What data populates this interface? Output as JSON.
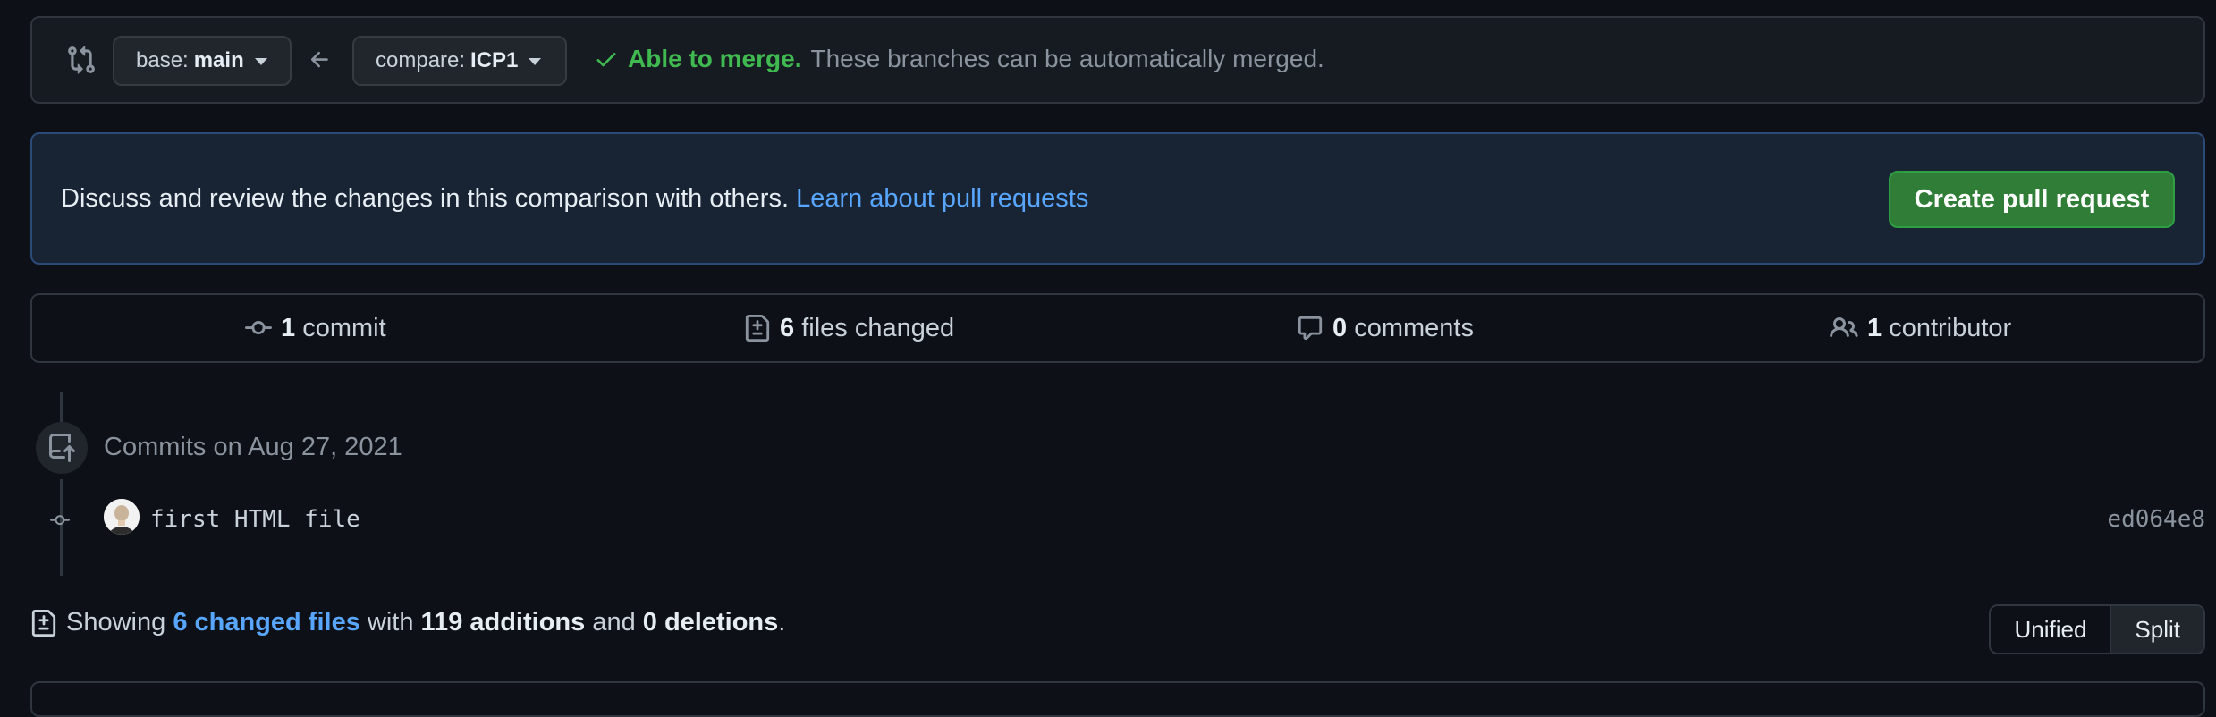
{
  "compare_bar": {
    "base_label": "base:",
    "base_value": "main",
    "compare_label": "compare:",
    "compare_value": "ICP1",
    "merge_status": "Able to merge.",
    "merge_description": "These branches can be automatically merged."
  },
  "info_banner": {
    "text": "Discuss and review the changes in this comparison with others.",
    "link": "Learn about pull requests",
    "button": "Create pull request"
  },
  "summary": {
    "commits_count": "1",
    "commits_label": "commit",
    "files_count": "6",
    "files_label": "files changed",
    "comments_count": "0",
    "comments_label": "comments",
    "contributors_count": "1",
    "contributors_label": "contributor"
  },
  "commits": {
    "date_heading": "Commits on Aug 27, 2021",
    "items": [
      {
        "message": "first HTML file",
        "sha": "ed064e8"
      }
    ]
  },
  "files_summary": {
    "prefix": "Showing",
    "changed_link": "6 changed files",
    "with": "with",
    "additions": "119 additions",
    "and": "and",
    "deletions": "0 deletions",
    "suffix": "."
  },
  "view_toggle": {
    "unified": "Unified",
    "split": "Split"
  },
  "colors": {
    "background": "#0d1117",
    "merge_ok": "#3fb950",
    "link": "#58a6ff",
    "primary_button": "#2f7d37"
  }
}
